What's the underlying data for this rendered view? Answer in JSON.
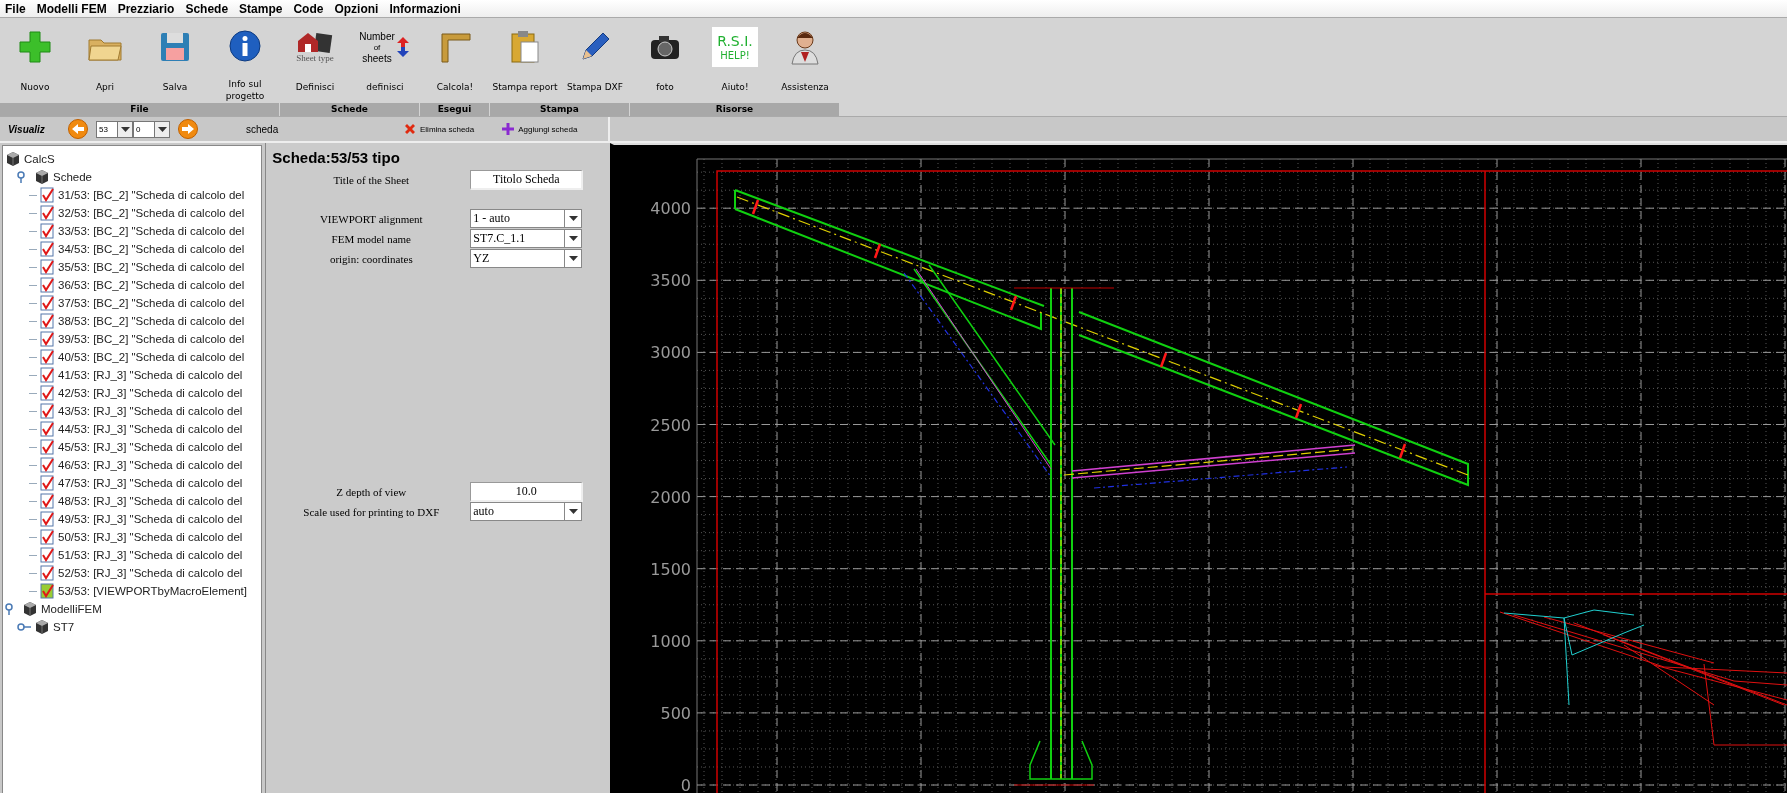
{
  "menu": [
    "File",
    "Modelli FEM",
    "Prezziario",
    "Schede",
    "Stampe",
    "Code",
    "Opzioni",
    "Informazioni"
  ],
  "toolbar": {
    "groups": [
      {
        "label": "File",
        "tools": [
          {
            "label": "Nuovo"
          },
          {
            "label": "Apri"
          },
          {
            "label": "Salva"
          },
          {
            "label": "Info sul progetto"
          }
        ]
      },
      {
        "label": "Schede",
        "tools": [
          {
            "label": "Definisci",
            "icon_text": [
              "Sheet type"
            ]
          },
          {
            "label": "definisci",
            "icon_text": [
              "Number",
              "of",
              "sheets"
            ]
          }
        ]
      },
      {
        "label": "Esegui",
        "tools": [
          {
            "label": "Calcola!"
          }
        ]
      },
      {
        "label": "Stampa",
        "tools": [
          {
            "label": "Stampa report"
          },
          {
            "label": "Stampa DXF"
          }
        ]
      },
      {
        "label": "Risorse",
        "tools": [
          {
            "label": "foto"
          },
          {
            "label": "Aiuto!",
            "icon_text": [
              "R.S.I.",
              "HELP!"
            ]
          },
          {
            "label": "Assistenza"
          }
        ]
      }
    ]
  },
  "navigator": {
    "label": "Visualiz",
    "sheet": "53",
    "sub": "0",
    "caption": "scheda",
    "delete": "Elimina scheda",
    "add": "Aggiungi scheda"
  },
  "tree": [
    {
      "label": "CalcS",
      "kind": "folder",
      "expanded": true,
      "children": [
        {
          "label": "Schede",
          "kind": "folder",
          "expanded": true,
          "children": [
            {
              "label": "31/53: [BC_2] \"Scheda di calcolo del",
              "kind": "sheet",
              "selected": false
            },
            {
              "label": "32/53: [BC_2] \"Scheda di calcolo del",
              "kind": "sheet",
              "selected": false
            },
            {
              "label": "33/53: [BC_2] \"Scheda di calcolo del",
              "kind": "sheet",
              "selected": false
            },
            {
              "label": "34/53: [BC_2] \"Scheda di calcolo del",
              "kind": "sheet",
              "selected": false
            },
            {
              "label": "35/53: [BC_2] \"Scheda di calcolo del",
              "kind": "sheet",
              "selected": false
            },
            {
              "label": "36/53: [BC_2] \"Scheda di calcolo del",
              "kind": "sheet",
              "selected": false
            },
            {
              "label": "37/53: [BC_2] \"Scheda di calcolo del",
              "kind": "sheet",
              "selected": false
            },
            {
              "label": "38/53: [BC_2] \"Scheda di calcolo del",
              "kind": "sheet",
              "selected": false
            },
            {
              "label": "39/53: [BC_2] \"Scheda di calcolo del",
              "kind": "sheet",
              "selected": false
            },
            {
              "label": "40/53: [BC_2] \"Scheda di calcolo del",
              "kind": "sheet",
              "selected": false
            },
            {
              "label": "41/53: [RJ_3] \"Scheda di calcolo del",
              "kind": "sheet",
              "selected": false
            },
            {
              "label": "42/53: [RJ_3] \"Scheda di calcolo del",
              "kind": "sheet",
              "selected": false
            },
            {
              "label": "43/53: [RJ_3] \"Scheda di calcolo del",
              "kind": "sheet",
              "selected": false
            },
            {
              "label": "44/53: [RJ_3] \"Scheda di calcolo del",
              "kind": "sheet",
              "selected": false
            },
            {
              "label": "45/53: [RJ_3] \"Scheda di calcolo del",
              "kind": "sheet",
              "selected": false
            },
            {
              "label": "46/53: [RJ_3] \"Scheda di calcolo del",
              "kind": "sheet",
              "selected": false
            },
            {
              "label": "47/53: [RJ_3] \"Scheda di calcolo del",
              "kind": "sheet",
              "selected": false
            },
            {
              "label": "48/53: [RJ_3] \"Scheda di calcolo del",
              "kind": "sheet",
              "selected": false
            },
            {
              "label": "49/53: [RJ_3] \"Scheda di calcolo del",
              "kind": "sheet",
              "selected": false
            },
            {
              "label": "50/53: [RJ_3] \"Scheda di calcolo del",
              "kind": "sheet",
              "selected": false
            },
            {
              "label": "51/53: [RJ_3] \"Scheda di calcolo del",
              "kind": "sheet",
              "selected": false
            },
            {
              "label": "52/53: [RJ_3] \"Scheda di calcolo del",
              "kind": "sheet",
              "selected": false
            },
            {
              "label": "53/53: [VIEWPORTbyMacroElement]",
              "kind": "sheet",
              "selected": true
            }
          ]
        }
      ]
    },
    {
      "label": "ModelliFEM",
      "kind": "folder",
      "expanded": true,
      "children": [
        {
          "label": "ST7",
          "kind": "folder",
          "expanded": false
        }
      ]
    }
  ],
  "form": {
    "title": "Scheda:53/53 tipo",
    "sections": [
      [
        {
          "label": "Title of the Sheet",
          "kind": "text",
          "value": "Titolo Scheda"
        }
      ],
      [
        {
          "label": "VIEWPORT alignment",
          "kind": "combo",
          "value": "1 - auto"
        },
        {
          "label": "FEM model name",
          "kind": "combo",
          "value": "ST7.C_1.1"
        },
        {
          "label": "origin: coordinates",
          "kind": "combo",
          "value": "YZ"
        }
      ],
      [
        {
          "label": "Z depth of view",
          "kind": "text",
          "value": "10.0"
        },
        {
          "label": "Scale used for printing to DXF",
          "kind": "combo",
          "value": "auto"
        }
      ]
    ]
  },
  "viewport": {
    "y_labels": [
      "4000",
      "3500",
      "3000",
      "2500",
      "2000",
      "1500",
      "1000",
      "500",
      "0"
    ]
  }
}
